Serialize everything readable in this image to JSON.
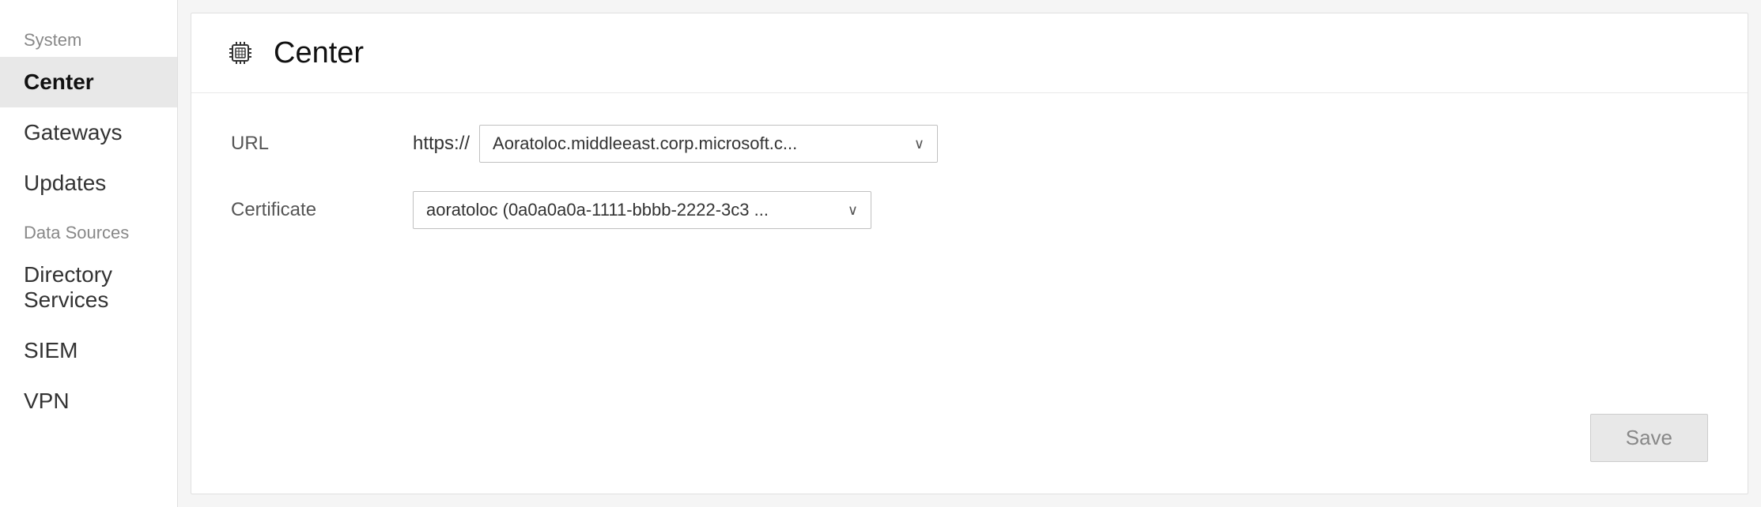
{
  "sidebar": {
    "system_label": "System",
    "items": [
      {
        "id": "center",
        "label": "Center",
        "active": true
      },
      {
        "id": "gateways",
        "label": "Gateways",
        "active": false
      },
      {
        "id": "updates",
        "label": "Updates",
        "active": false
      }
    ],
    "data_sources_label": "Data Sources",
    "data_source_items": [
      {
        "id": "directory-services",
        "label": "Directory Services",
        "active": false
      },
      {
        "id": "siem",
        "label": "SIEM",
        "active": false
      },
      {
        "id": "vpn",
        "label": "VPN",
        "active": false
      }
    ]
  },
  "main": {
    "panel_title": "Center",
    "form": {
      "url_label": "URL",
      "url_prefix": "https://",
      "url_value": "Aoratoloc.middleeast.corp.microsoft.c...",
      "cert_label": "Certificate",
      "cert_value": "aoratoloc (0a0a0a0a-1111-bbbb-2222-3c3 ..."
    },
    "save_button_label": "Save"
  }
}
